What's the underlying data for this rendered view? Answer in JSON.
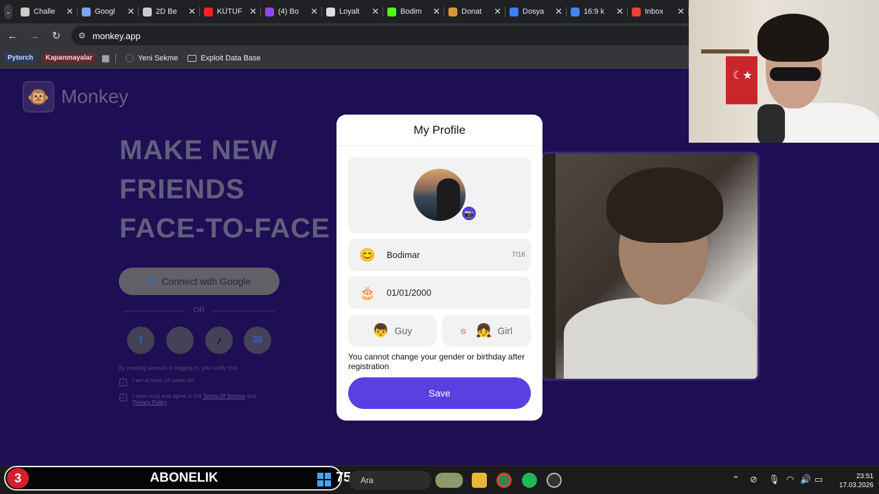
{
  "browser": {
    "tabs": [
      {
        "label": "Challe",
        "icon": "unity-icon",
        "color": "#cccccc"
      },
      {
        "label": "Googl",
        "icon": "gemini-icon",
        "color": "#7aa6ff"
      },
      {
        "label": "2D Be",
        "icon": "unity-icon",
        "color": "#cccccc"
      },
      {
        "label": "KÜTÜF",
        "icon": "youtube-icon",
        "color": "#ff2020"
      },
      {
        "label": "(4) Bo",
        "icon": "twitch-icon",
        "color": "#9146ff"
      },
      {
        "label": "Loyalt",
        "icon": "github-icon",
        "color": "#dddddd"
      },
      {
        "label": "Bodim",
        "icon": "kick-icon",
        "color": "#53fc18"
      },
      {
        "label": "Donat",
        "icon": "donate-icon",
        "color": "#d79a3a"
      },
      {
        "label": "Dosya",
        "icon": "drive-icon",
        "color": "#3b82f6"
      },
      {
        "label": "16:9 k",
        "icon": "google-icon",
        "color": "#4285f4"
      },
      {
        "label": "Inbox",
        "icon": "gmail-icon",
        "color": "#ea4335"
      }
    ],
    "url": "monkey.app",
    "bookmarks": {
      "chip1": "Pytorch",
      "chip2": "Kapanmayalar",
      "item1": "Yeni Sekme",
      "item2": "Exploit Data Base"
    }
  },
  "page": {
    "logo_text": "Monkey",
    "hero_lines": [
      "MAKE NEW",
      "FRIENDS",
      "FACE-TO-FACE"
    ],
    "google_button": "Connect with Google",
    "or_text": "OR",
    "legal_text": "By creating account or logging in, you certify that",
    "check1": "I am at least 18 years old",
    "check2_prefix": "I have read and agree to the ",
    "check2_link1": "Terms Of Service",
    "check2_mid": " and",
    "check2_link2": "Privacy Policy"
  },
  "modal": {
    "title": "My Profile",
    "name_value": "Bodimar",
    "name_counter": "7/16",
    "birthday_value": "01/01/2000",
    "gender_guy": "Guy",
    "gender_girl": "Girl",
    "warning": "You cannot change your gender or birthday after registration",
    "save_label": "Save"
  },
  "taskbar": {
    "sub_count": "3",
    "sub_label": "ABONELIK",
    "temperature": "75",
    "search_placeholder": "Ara",
    "time": "23:51",
    "date": "17.03.2026"
  },
  "colors": {
    "page_bg": "#21105c",
    "accent": "#5b3fe0",
    "modal_bg": "#ffffff"
  }
}
